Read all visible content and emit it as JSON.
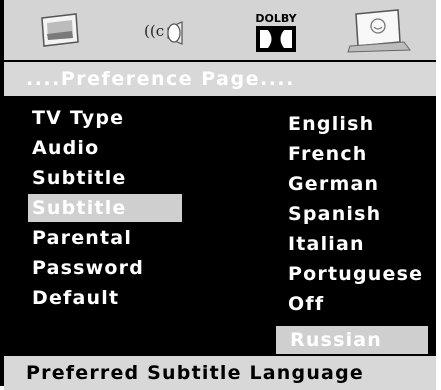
{
  "icons": [
    {
      "name": "tv-screen-icon"
    },
    {
      "name": "audio-icon"
    },
    {
      "name": "dolby-icon",
      "label": "DOLBY"
    },
    {
      "name": "preference-icon"
    }
  ],
  "header": {
    "title": "....Preference Page...."
  },
  "menu": {
    "items": [
      {
        "label": "TV Type"
      },
      {
        "label": "Audio"
      },
      {
        "label": "Subtitle"
      },
      {
        "label": "Subtitle"
      },
      {
        "label": "Parental"
      },
      {
        "label": "Password"
      },
      {
        "label": "Default"
      }
    ],
    "selected_index": 3
  },
  "options": {
    "items": [
      {
        "label": "English"
      },
      {
        "label": "French"
      },
      {
        "label": "German"
      },
      {
        "label": "Spanish"
      },
      {
        "label": "Italian"
      },
      {
        "label": "Portuguese"
      },
      {
        "label": "Off"
      },
      {
        "label": "Russian"
      }
    ],
    "selected_index": 7
  },
  "footer": {
    "text": "Preferred Subtitle Language"
  },
  "colors": {
    "highlight": "#cfcfcf",
    "background": "#000000",
    "bar": "#d8d8d8"
  }
}
